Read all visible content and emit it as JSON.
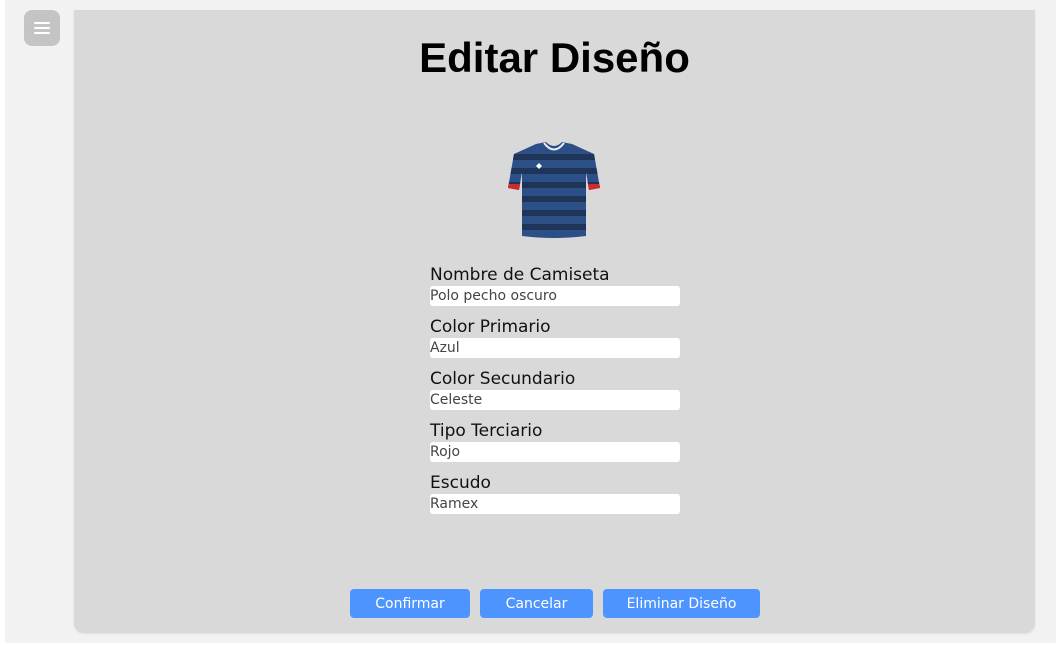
{
  "page": {
    "title": "Editar Diseño"
  },
  "menu": {
    "icon": "hamburger-menu-icon"
  },
  "jersey": {
    "icon": "jersey-image",
    "primary_color": "#2b4f86",
    "stripe_color": "#1e3458",
    "trim_color": "#d02a2a"
  },
  "form": {
    "fields": [
      {
        "label": "Nombre de Camiseta",
        "value": "Polo pecho oscuro"
      },
      {
        "label": "Color Primario",
        "value": "Azul"
      },
      {
        "label": "Color Secundario",
        "value": "Celeste"
      },
      {
        "label": "Tipo Terciario",
        "value": "Rojo"
      },
      {
        "label": "Escudo",
        "value": "Ramex"
      }
    ]
  },
  "actions": {
    "confirm_label": "Confirmar",
    "cancel_label": "Cancelar",
    "delete_label": "Eliminar Diseño",
    "button_color": "#4d94ff"
  }
}
